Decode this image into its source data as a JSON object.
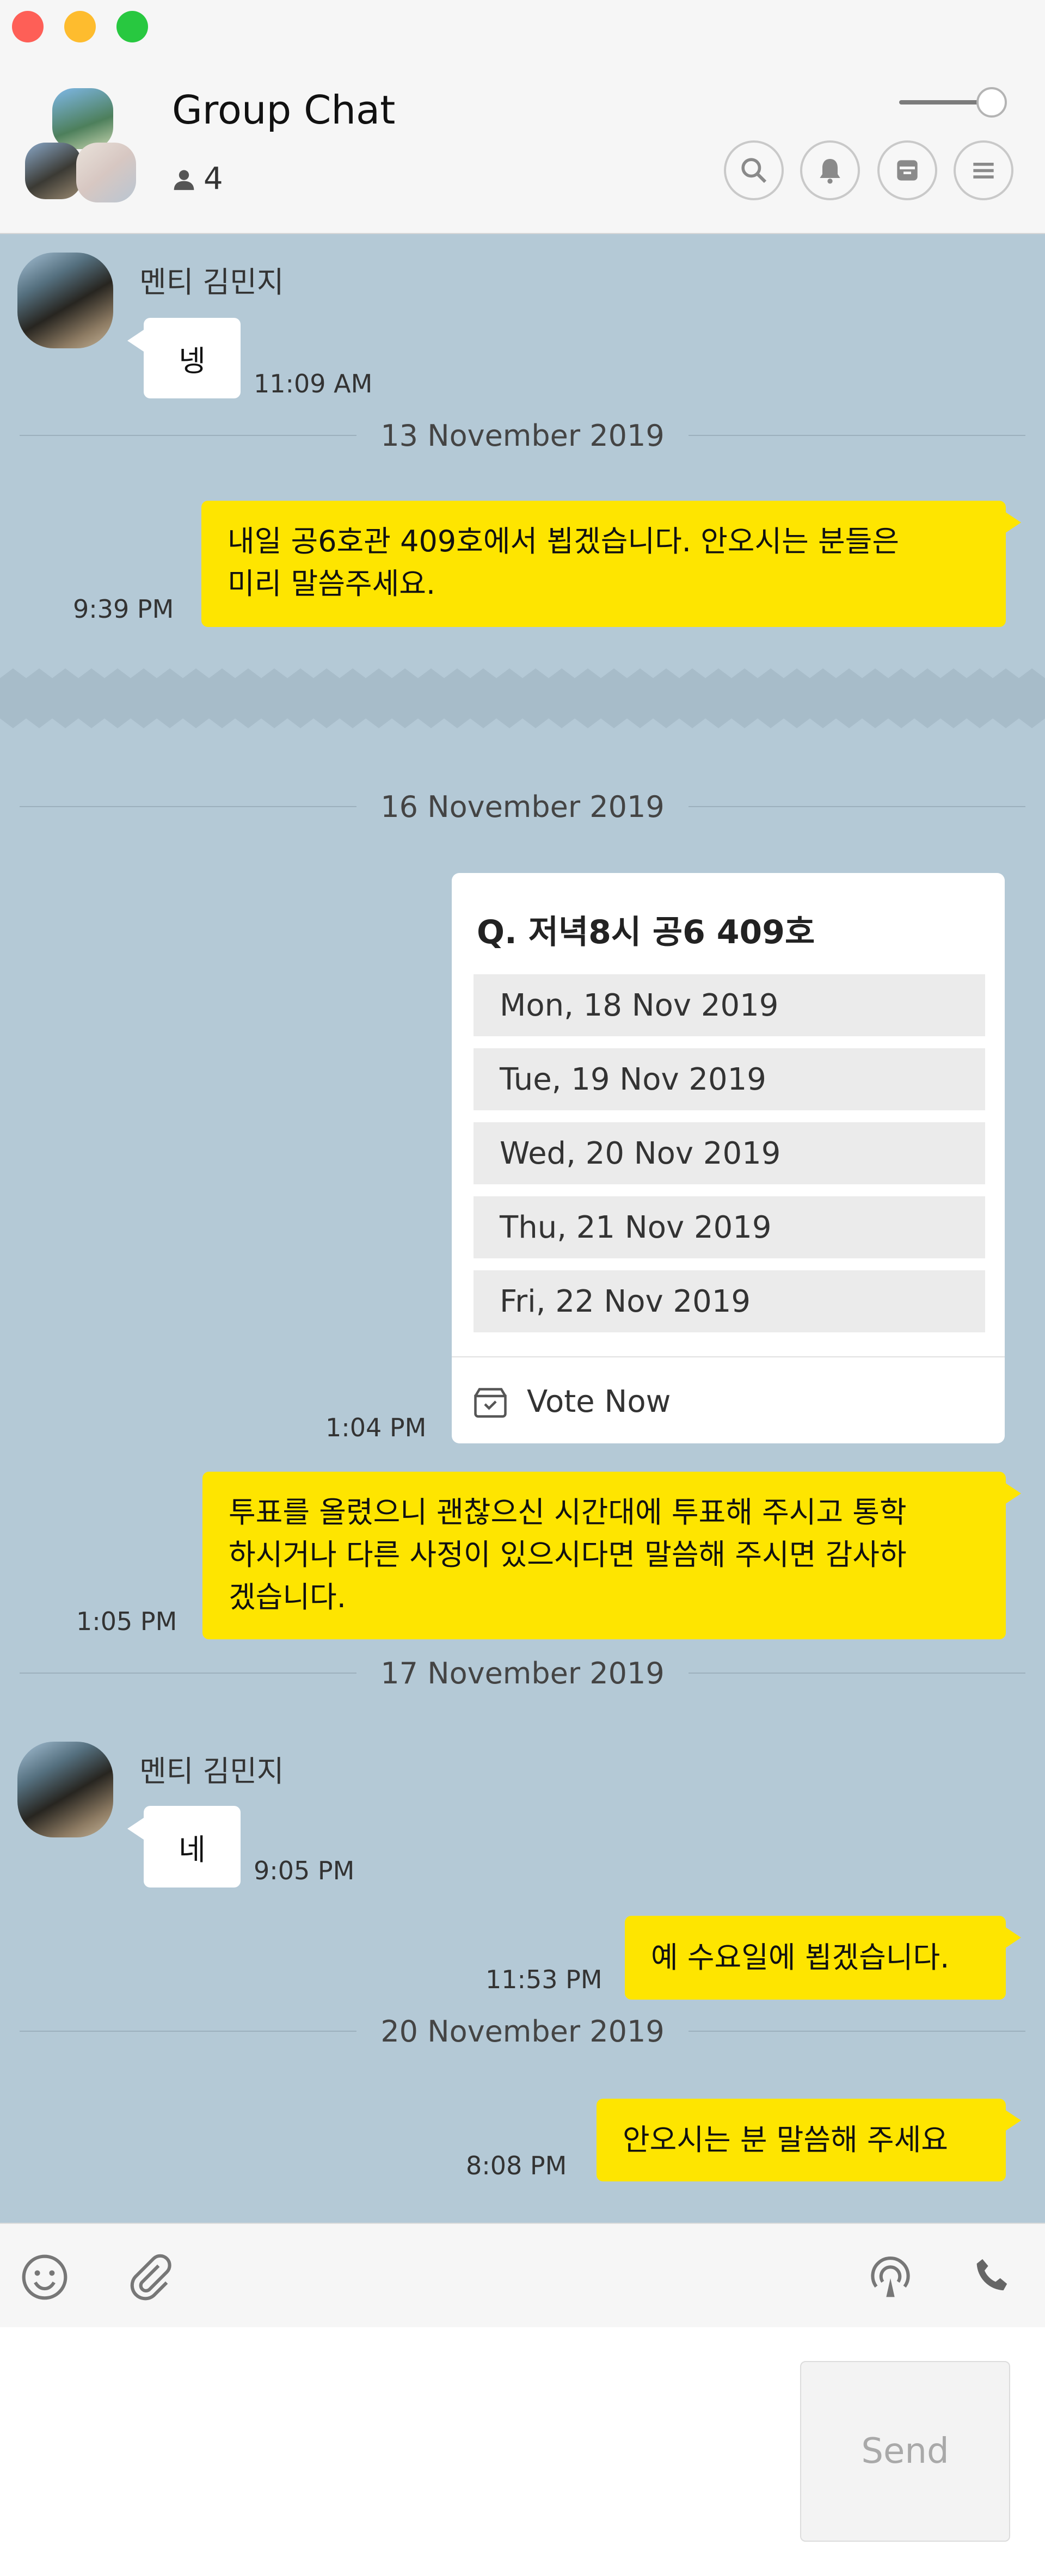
{
  "window": {
    "title": "Group Chat",
    "member_count": "4"
  },
  "header": {
    "buttons": [
      "search-icon",
      "bell-icon",
      "archive-icon",
      "menu-icon"
    ]
  },
  "messages": {
    "m1": {
      "sender": "멘티 김민지",
      "text": "넹",
      "time": "11:09 AM"
    },
    "d1": "13 November 2019",
    "m2": {
      "text_line1": "내일 공6호관 409호에서 뵙겠습니다. 안오시는 분들은",
      "text_line2": "미리 말씀주세요.",
      "time": "9:39 PM"
    },
    "d2": "16 November 2019",
    "vote": {
      "question": "Q. 저녁8시 공6 409호",
      "options": [
        "Mon, 18 Nov 2019",
        "Tue, 19 Nov 2019",
        "Wed, 20 Nov 2019",
        "Thu, 21 Nov 2019",
        "Fri, 22 Nov 2019"
      ],
      "action": "Vote Now",
      "time": "1:04 PM"
    },
    "m3": {
      "text_line1": "투표를 올렸으니 괜찮으신 시간대에 투표해 주시고 통학",
      "text_line2": "하시거나 다른 사정이 있으시다면 말씀해 주시면 감사하",
      "text_line3": "겠습니다.",
      "time": "1:05 PM"
    },
    "d3": "17 November 2019",
    "m4": {
      "sender": "멘티 김민지",
      "text": "네",
      "time": "9:05 PM"
    },
    "m5": {
      "text": "예 수요일에 뵙겠습니다.",
      "time": "11:53 PM"
    },
    "d4": "20 November 2019",
    "m6": {
      "text": "안오시는 분 말씀해 주세요",
      "time": "8:08 PM"
    }
  },
  "toolbar": {
    "icons": [
      "emoji-icon",
      "attach-icon",
      "airdrop-icon",
      "phone-icon"
    ]
  },
  "composer": {
    "placeholder": "",
    "send_label": "Send"
  },
  "colors": {
    "chat_bg": "#b4c9d6",
    "my_bubble": "#fee500",
    "other_bubble": "#ffffff"
  }
}
